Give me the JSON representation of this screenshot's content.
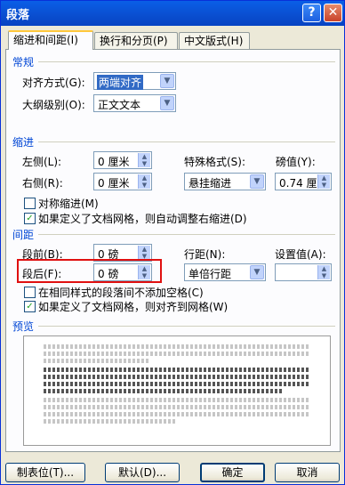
{
  "window": {
    "title": "段落"
  },
  "tabs": [
    {
      "label": "缩进和间距(I)"
    },
    {
      "label": "换行和分页(P)"
    },
    {
      "label": "中文版式(H)"
    }
  ],
  "general": {
    "section_label": "常规",
    "alignment_label": "对齐方式(G):",
    "alignment_value": "两端对齐",
    "outline_label": "大纲级别(O):",
    "outline_value": "正文文本"
  },
  "indent": {
    "section_label": "缩进",
    "left_label": "左侧(L):",
    "left_value": "0 厘米",
    "right_label": "右侧(R):",
    "right_value": "0 厘米",
    "special_label": "特殊格式(S):",
    "special_value": "悬挂缩进",
    "by_label": "磅值(Y):",
    "by_value": "0.74 厘米",
    "mirror_label": "对称缩进(M)",
    "mirror_checked": false,
    "grid_label": "如果定义了文档网格，则自动调整右缩进(D)",
    "grid_checked": true
  },
  "spacing": {
    "section_label": "间距",
    "before_label": "段前(B):",
    "before_value": "0 磅",
    "after_label": "段后(F):",
    "after_value": "0 磅",
    "line_label": "行距(N):",
    "line_value": "单倍行距",
    "at_label": "设置值(A):",
    "at_value": "",
    "no_space_label": "在相同样式的段落间不添加空格(C)",
    "no_space_checked": false,
    "snap_label": "如果定义了文档网格，则对齐到网格(W)",
    "snap_checked": true
  },
  "preview": {
    "section_label": "预览"
  },
  "buttons": {
    "tabs": "制表位(T)...",
    "default": "默认(D)...",
    "ok": "确定",
    "cancel": "取消"
  },
  "colors": {
    "section": "#0046d5",
    "highlight": "#e01010",
    "accent": "#0a5fe7"
  }
}
